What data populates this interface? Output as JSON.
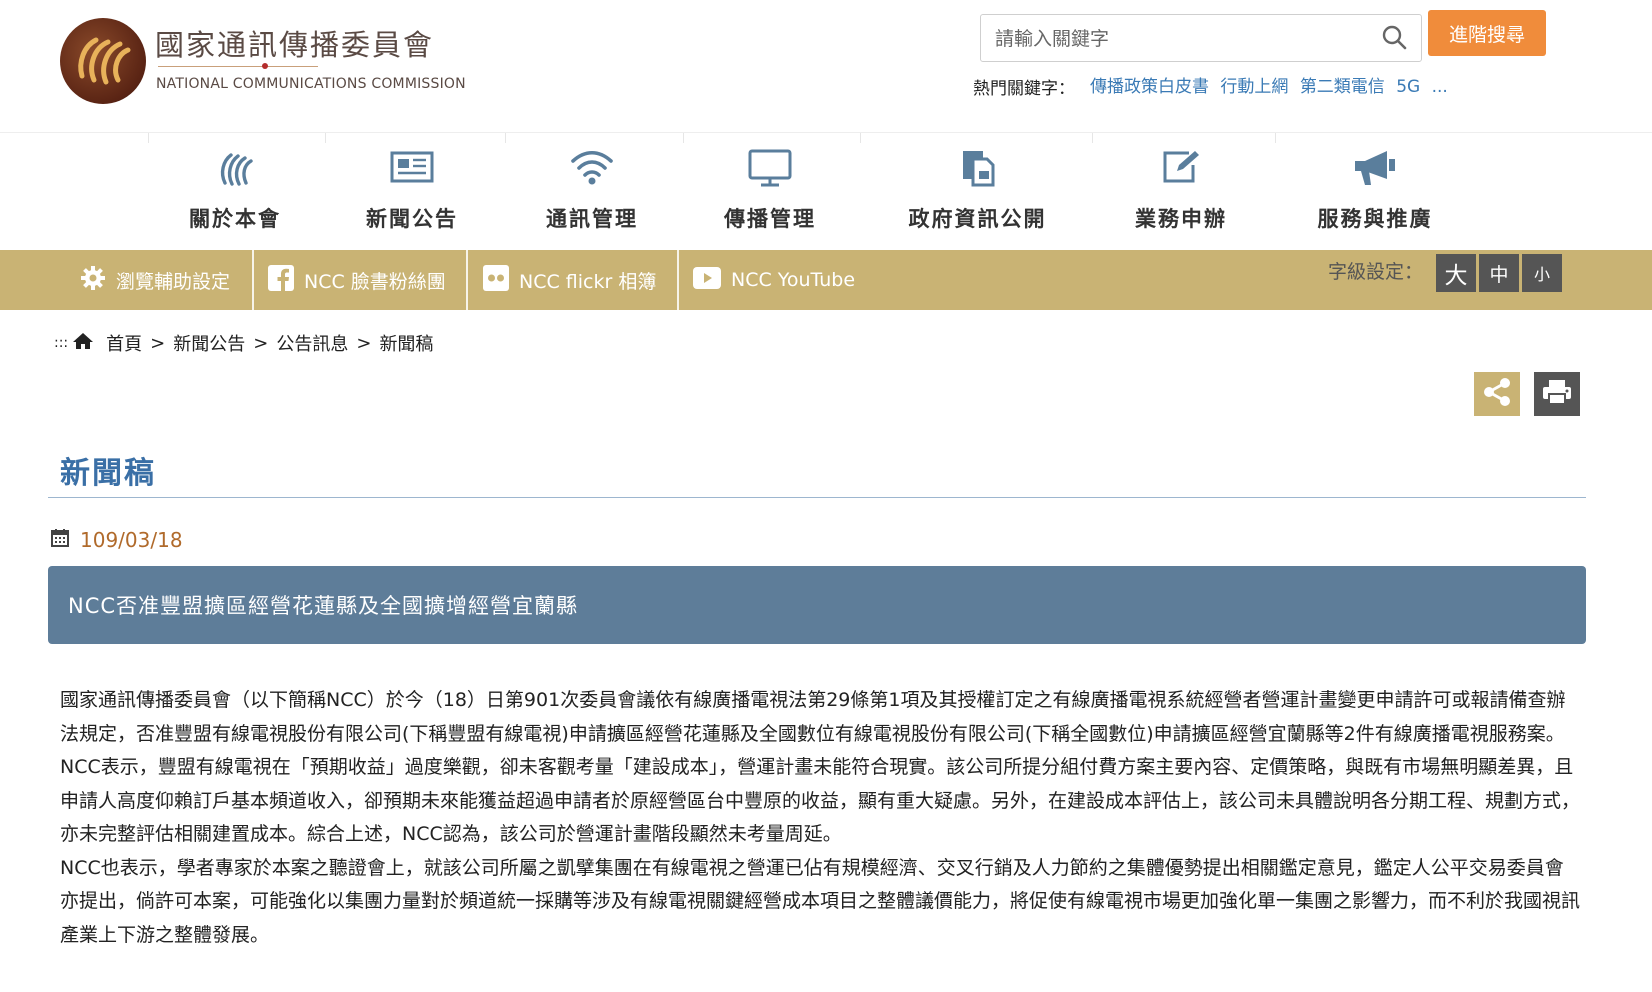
{
  "header": {
    "site_title": "國家通訊傳播委員會",
    "site_subtitle": "NATIONAL COMMUNICATIONS COMMISSION",
    "search_placeholder": "請輸入關鍵字",
    "advanced_search": "進階搜尋",
    "hot_label": "熱門關鍵字：",
    "hot_keywords": [
      "傳播政策白皮書",
      "行動上網",
      "第二類電信",
      "5G",
      "..."
    ]
  },
  "mainnav": {
    "items": [
      {
        "label": "關於本會",
        "icon": "ncc-waves-icon"
      },
      {
        "label": "新聞公告",
        "icon": "newspaper-icon"
      },
      {
        "label": "通訊管理",
        "icon": "wifi-icon"
      },
      {
        "label": "傳播管理",
        "icon": "monitor-icon"
      },
      {
        "label": "政府資訊公開",
        "icon": "documents-icon"
      },
      {
        "label": "業務申辦",
        "icon": "edit-icon"
      },
      {
        "label": "服務與推廣",
        "icon": "megaphone-icon"
      }
    ]
  },
  "utilbar": {
    "accessibility": "瀏覽輔助設定",
    "facebook": "NCC 臉書粉絲團",
    "flickr": "NCC flickr 相簿",
    "youtube": "NCC YouTube",
    "font_size_label": "字級設定：",
    "font_large": "大",
    "font_medium": "中",
    "font_small": "小"
  },
  "breadcrumb": {
    "prefix": ":::",
    "items": [
      "首頁",
      "新聞公告",
      "公告訊息",
      "新聞稿"
    ],
    "separator": ">"
  },
  "content": {
    "heading": "新聞稿",
    "date": "109/03/18",
    "title": "NCC否准豐盟擴區經營花蓮縣及全國擴增經營宜蘭縣",
    "paragraphs": [
      "國家通訊傳播委員會（以下簡稱NCC）於今（18）日第901次委員會議依有線廣播電視法第29條第1項及其授權訂定之有線廣播電視系統經營者營運計畫變更申請許可或報請備查辦法規定，否准豐盟有線電視股份有限公司(下稱豐盟有線電視)申請擴區經營花蓮縣及全國數位有線電視股份有限公司(下稱全國數位)申請擴區經營宜蘭縣等2件有線廣播電視服務案。",
      "NCC表示，豐盟有線電視在「預期收益」過度樂觀，卻未客觀考量「建設成本」，營運計畫未能符合現實。該公司所提分組付費方案主要內容、定價策略，與既有市場無明顯差異，且申請人高度仰賴訂戶基本頻道收入，卻預期未來能獲益超過申請者於原經營區台中豐原的收益，顯有重大疑慮。另外，在建設成本評估上，該公司未具體說明各分期工程、規劃方式，亦未完整評估相關建置成本。綜合上述，NCC認為，該公司於營運計畫階段顯然未考量周延。",
      "NCC也表示，學者專家於本案之聽證會上，就該公司所屬之凱擘集團在有線電視之營運已佔有規模經濟、交叉行銷及人力節約之集體優勢提出相關鑑定意見，鑑定人公平交易委員會亦提出，倘許可本案，可能強化以集團力量對於頻道統一採購等涉及有線電視關鍵經營成本項目之整體議價能力，將促使有線電視市場更加強化單一集團之影響力，而不利於我國視訊產業上下游之整體發展。"
    ]
  }
}
